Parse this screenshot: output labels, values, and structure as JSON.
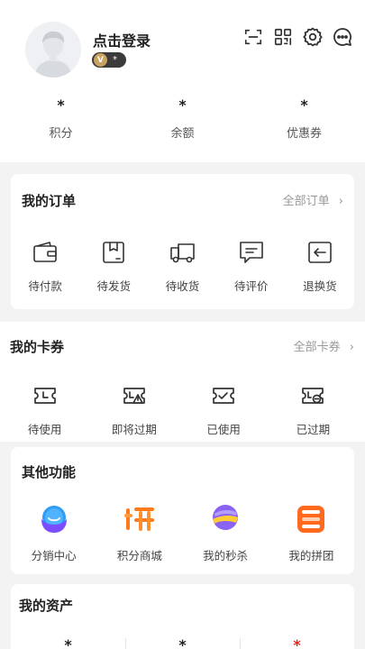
{
  "profile": {
    "login_text": "点击登录",
    "vip_badge": "V",
    "vip_level": "*"
  },
  "top_icons": [
    "scan-icon",
    "qr-code-icon",
    "settings-icon",
    "message-icon"
  ],
  "stats": [
    {
      "value": "*",
      "label": "积分"
    },
    {
      "value": "*",
      "label": "余额"
    },
    {
      "value": "*",
      "label": "优惠券"
    }
  ],
  "orders": {
    "title": "我的订单",
    "link": "全部订单",
    "items": [
      {
        "label": "待付款",
        "icon": "wallet-icon"
      },
      {
        "label": "待发货",
        "icon": "package-icon"
      },
      {
        "label": "待收货",
        "icon": "truck-icon"
      },
      {
        "label": "待评价",
        "icon": "comment-icon"
      },
      {
        "label": "退换货",
        "icon": "return-icon"
      }
    ]
  },
  "coupons": {
    "title": "我的卡券",
    "link": "全部卡券",
    "items": [
      {
        "label": "待使用",
        "icon": "coupon-unused-icon"
      },
      {
        "label": "即将过期",
        "icon": "coupon-expiring-icon"
      },
      {
        "label": "已使用",
        "icon": "coupon-used-icon"
      },
      {
        "label": "已过期",
        "icon": "coupon-expired-icon"
      }
    ]
  },
  "others": {
    "title": "其他功能",
    "items": [
      {
        "label": "分销中心",
        "icon": "distribution-icon"
      },
      {
        "label": "积分商城",
        "icon": "points-mall-icon"
      },
      {
        "label": "我的秒杀",
        "icon": "flash-sale-icon"
      },
      {
        "label": "我的拼团",
        "icon": "group-buy-icon"
      }
    ]
  },
  "assets": {
    "title": "我的资产",
    "values": [
      "*",
      "*",
      "*"
    ]
  },
  "colors": {
    "accent_red": "#e02020",
    "link_gray": "#999999",
    "icon_stroke": "#333333"
  }
}
